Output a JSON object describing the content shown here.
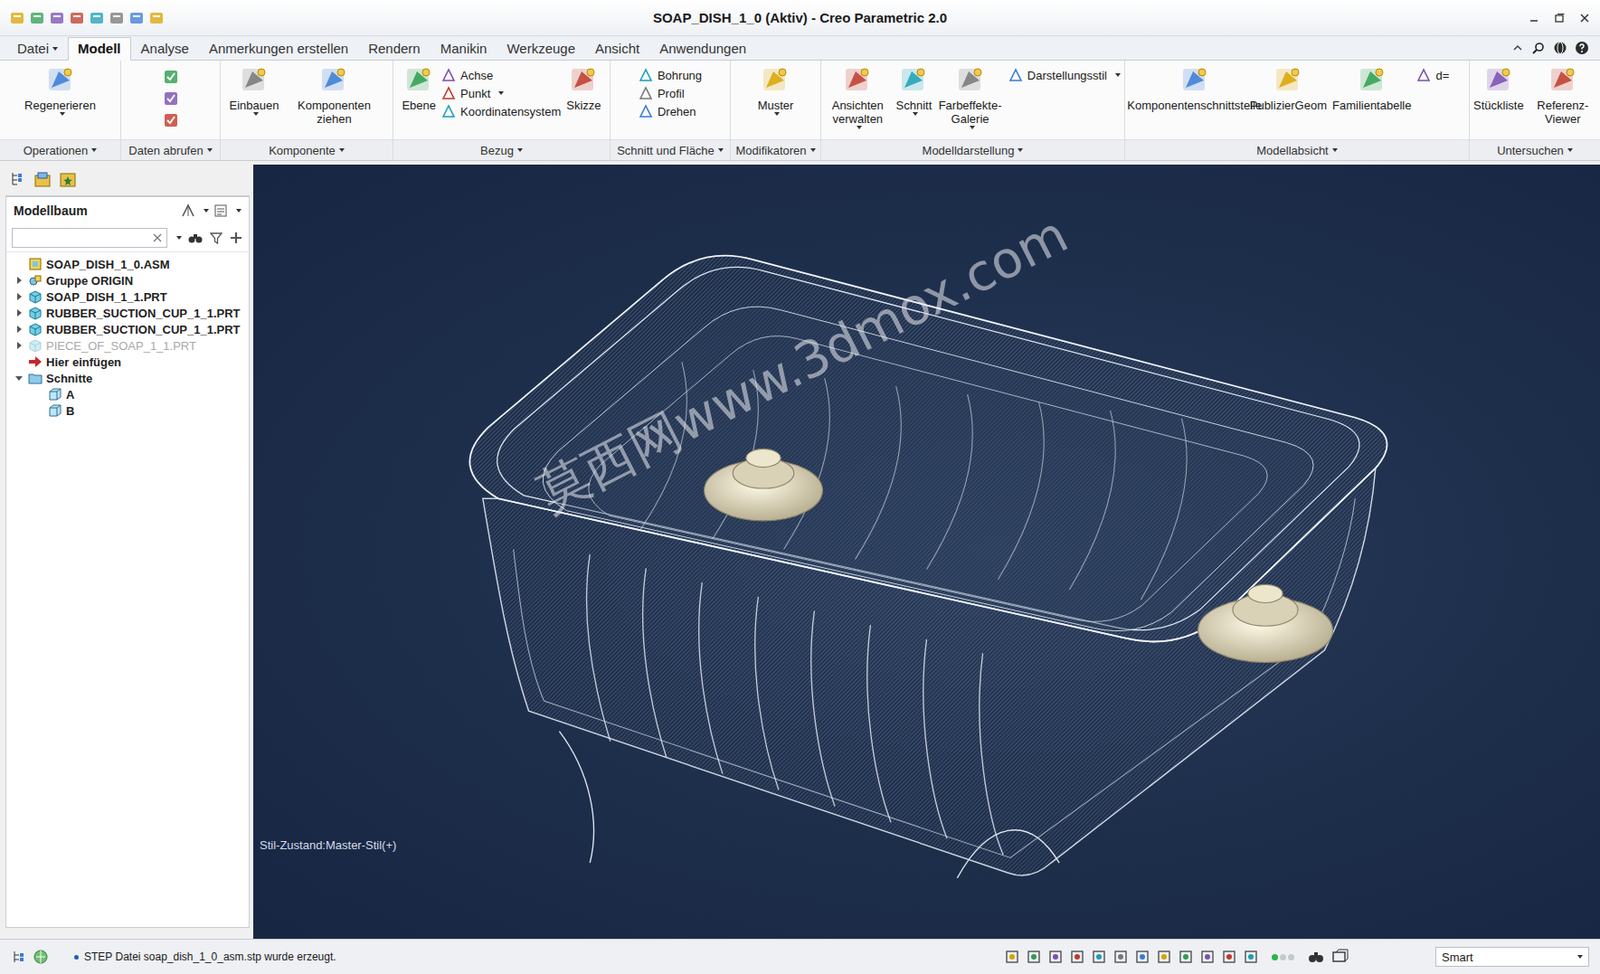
{
  "window": {
    "title": "SOAP_DISH_1_0 (Aktiv) - Creo Parametric 2.0"
  },
  "menu_tabs": [
    {
      "label": "Datei",
      "selected": false,
      "dropdown": true
    },
    {
      "label": "Modell",
      "selected": true,
      "dropdown": false
    },
    {
      "label": "Analyse",
      "selected": false,
      "dropdown": false
    },
    {
      "label": "Anmerkungen erstellen",
      "selected": false,
      "dropdown": false
    },
    {
      "label": "Rendern",
      "selected": false,
      "dropdown": false
    },
    {
      "label": "Manikin",
      "selected": false,
      "dropdown": false
    },
    {
      "label": "Werkzeuge",
      "selected": false,
      "dropdown": false
    },
    {
      "label": "Ansicht",
      "selected": false,
      "dropdown": false
    },
    {
      "label": "Anwendungen",
      "selected": false,
      "dropdown": false
    }
  ],
  "ribbon_groups": [
    {
      "label": "Operationen",
      "dropdown": true,
      "columns": [
        {
          "kind": "large",
          "items": [
            {
              "label": "Regenerieren",
              "dropdown": true
            }
          ]
        }
      ]
    },
    {
      "label": "Daten abrufen",
      "dropdown": true,
      "columns": []
    },
    {
      "label": "Komponente",
      "dropdown": true,
      "columns": [
        {
          "kind": "large",
          "items": [
            {
              "label": "Einbauen",
              "dropdown": true
            }
          ]
        },
        {
          "kind": "large",
          "items": [
            {
              "label": "Komponenten ziehen",
              "dropdown": false
            }
          ]
        }
      ]
    },
    {
      "label": "Bezug",
      "dropdown": true,
      "columns": [
        {
          "kind": "large",
          "items": [
            {
              "label": "Ebene",
              "dropdown": false
            }
          ]
        },
        {
          "kind": "small",
          "items": [
            {
              "label": "Achse",
              "dropdown": false
            },
            {
              "label": "Punkt",
              "dropdown": true
            },
            {
              "label": "Koordinatensystem",
              "dropdown": false
            }
          ]
        },
        {
          "kind": "large",
          "items": [
            {
              "label": "Skizze",
              "dropdown": false
            }
          ]
        }
      ]
    },
    {
      "label": "Schnitt und Fläche",
      "dropdown": true,
      "columns": [
        {
          "kind": "small",
          "items": [
            {
              "label": "Bohrung",
              "dropdown": false
            },
            {
              "label": "Profil",
              "dropdown": false
            },
            {
              "label": "Drehen",
              "dropdown": false
            }
          ]
        }
      ]
    },
    {
      "label": "Modifikatoren",
      "dropdown": true,
      "columns": [
        {
          "kind": "large",
          "items": [
            {
              "label": "Muster",
              "dropdown": true
            }
          ]
        }
      ]
    },
    {
      "label": "Modelldarstellung",
      "dropdown": true,
      "columns": [
        {
          "kind": "large",
          "items": [
            {
              "label": "Ansichten verwalten",
              "dropdown": true
            }
          ]
        },
        {
          "kind": "large",
          "items": [
            {
              "label": "Schnitt",
              "dropdown": true
            }
          ]
        },
        {
          "kind": "large",
          "items": [
            {
              "label": "Farbeffekte-Galerie",
              "dropdown": true
            }
          ]
        },
        {
          "kind": "small",
          "items": [
            {
              "label": "Darstellungsstil",
              "dropdown": true
            }
          ]
        }
      ]
    },
    {
      "label": "Modellabsicht",
      "dropdown": true,
      "columns": [
        {
          "kind": "large",
          "items": [
            {
              "label": "Komponentenschnittstelle",
              "dropdown": false
            }
          ]
        },
        {
          "kind": "large",
          "items": [
            {
              "label": "PublizierGeom",
              "dropdown": false
            }
          ]
        },
        {
          "kind": "large",
          "items": [
            {
              "label": "Familientabelle",
              "dropdown": false
            }
          ]
        },
        {
          "kind": "small",
          "items": [
            {
              "label": "d=",
              "dropdown": false
            }
          ]
        }
      ]
    },
    {
      "label": "Untersuchen",
      "dropdown": true,
      "columns": [
        {
          "kind": "large",
          "items": [
            {
              "label": "Stückliste",
              "dropdown": false
            }
          ]
        },
        {
          "kind": "large",
          "items": [
            {
              "label": "Referenz-Viewer",
              "dropdown": false
            }
          ]
        }
      ]
    }
  ],
  "model_tree": {
    "title": "Modellbaum",
    "items": [
      {
        "label": "SOAP_DISH_1_0.ASM",
        "level": 0,
        "kind": "assembly",
        "expandable": false,
        "expanded": false,
        "disabled": false
      },
      {
        "label": "Gruppe ORIGIN",
        "level": 0,
        "kind": "group",
        "expandable": true,
        "expanded": false,
        "disabled": false
      },
      {
        "label": "SOAP_DISH_1_1.PRT",
        "level": 0,
        "kind": "part",
        "expandable": true,
        "expanded": false,
        "disabled": false
      },
      {
        "label": "RUBBER_SUCTION_CUP_1_1.PRT",
        "level": 0,
        "kind": "part",
        "expandable": true,
        "expanded": false,
        "disabled": false
      },
      {
        "label": "RUBBER_SUCTION_CUP_1_1.PRT",
        "level": 0,
        "kind": "part",
        "expandable": true,
        "expanded": false,
        "disabled": false
      },
      {
        "label": "PIECE_OF_SOAP_1_1.PRT",
        "level": 0,
        "kind": "part",
        "expandable": true,
        "expanded": false,
        "disabled": true
      },
      {
        "label": "Hier einfügen",
        "level": 0,
        "kind": "insert",
        "expandable": false,
        "expanded": false,
        "disabled": false
      },
      {
        "label": "Schnitte",
        "level": 0,
        "kind": "folder",
        "expandable": true,
        "expanded": true,
        "disabled": false
      },
      {
        "label": "A",
        "level": 1,
        "kind": "section",
        "expandable": false,
        "expanded": false,
        "disabled": false
      },
      {
        "label": "B",
        "level": 1,
        "kind": "section",
        "expandable": false,
        "expanded": false,
        "disabled": false
      }
    ]
  },
  "viewport": {
    "style_state": "Stil-Zustand:Master-Stil(+)",
    "watermark": "莫西网www.3dmox.com"
  },
  "status_bar": {
    "message": "STEP Datei soap_dish_1_0_asm.stp wurde erzeugt.",
    "selection_filter": "Smart"
  }
}
